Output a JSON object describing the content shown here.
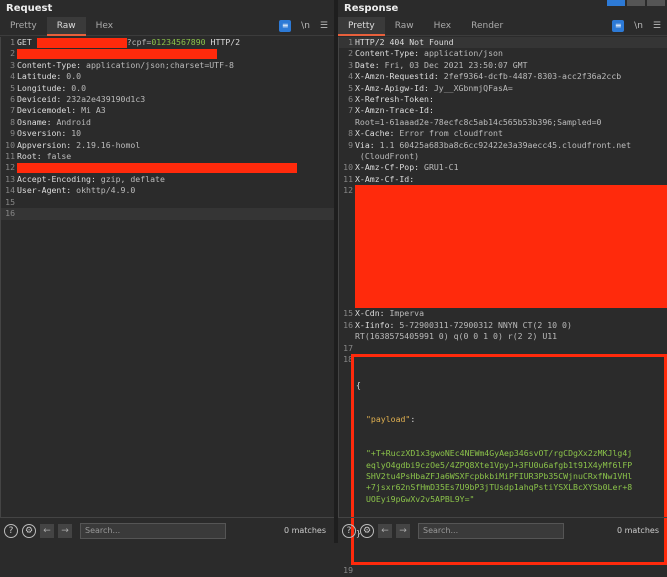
{
  "request": {
    "title": "Request",
    "tabs": [
      "Pretty",
      "Raw",
      "Hex"
    ],
    "active_tab": "Raw",
    "lines": [
      {
        "n": "1",
        "parts": [
          [
            "GET ",
            "key"
          ],
          [
            "",
            "red90"
          ],
          [
            "?cpf=",
            "val"
          ],
          [
            "01234567890",
            "grn"
          ],
          [
            " HTTP/2",
            "key"
          ]
        ]
      },
      {
        "n": "2",
        "parts": [
          [
            "",
            "red200"
          ]
        ]
      },
      {
        "n": "3",
        "parts": [
          [
            "Content-Type:",
            "key"
          ],
          [
            " application/json;charset=UTF-8",
            "val"
          ]
        ]
      },
      {
        "n": "4",
        "parts": [
          [
            "Latitude:",
            "key"
          ],
          [
            " 0.0",
            "val"
          ]
        ]
      },
      {
        "n": "5",
        "parts": [
          [
            "Longitude:",
            "key"
          ],
          [
            " 0.0",
            "val"
          ]
        ]
      },
      {
        "n": "6",
        "parts": [
          [
            "Deviceid:",
            "key"
          ],
          [
            " 232a2e439190d1c3",
            "val"
          ]
        ]
      },
      {
        "n": "7",
        "parts": [
          [
            "Devicemodel:",
            "key"
          ],
          [
            " Mi A3",
            "val"
          ]
        ]
      },
      {
        "n": "8",
        "parts": [
          [
            "Osname:",
            "key"
          ],
          [
            " Android",
            "val"
          ]
        ]
      },
      {
        "n": "9",
        "parts": [
          [
            "Osversion:",
            "key"
          ],
          [
            " 10",
            "val"
          ]
        ]
      },
      {
        "n": "10",
        "parts": [
          [
            "Appversion:",
            "key"
          ],
          [
            " 2.19.16-homol",
            "val"
          ]
        ]
      },
      {
        "n": "11",
        "parts": [
          [
            "Root:",
            "key"
          ],
          [
            " false",
            "val"
          ]
        ]
      },
      {
        "n": "12",
        "parts": [
          [
            "",
            "red280"
          ]
        ]
      },
      {
        "n": "13",
        "parts": [
          [
            "Accept-Encoding:",
            "key"
          ],
          [
            " gzip, deflate",
            "val"
          ]
        ]
      },
      {
        "n": "14",
        "parts": [
          [
            "User-Agent:",
            "key"
          ],
          [
            " okhttp/4.9.0",
            "val"
          ]
        ]
      },
      {
        "n": "15",
        "parts": []
      },
      {
        "n": "16",
        "parts": [],
        "hl": true
      }
    ]
  },
  "response": {
    "title": "Response",
    "tabs": [
      "Pretty",
      "Raw",
      "Hex",
      "Render"
    ],
    "active_tab": "Pretty",
    "lines": [
      {
        "n": "1",
        "parts": [
          [
            "HTTP/2 404 Not Found",
            "key"
          ]
        ],
        "hl": true
      },
      {
        "n": "2",
        "parts": [
          [
            "Content-Type:",
            "key"
          ],
          [
            " application/json",
            "val"
          ]
        ]
      },
      {
        "n": "3",
        "parts": [
          [
            "Date:",
            "key"
          ],
          [
            " Fri, 03 Dec 2021 23:50:07 GMT",
            "val"
          ]
        ]
      },
      {
        "n": "4",
        "parts": [
          [
            "X-Amzn-Requestid:",
            "key"
          ],
          [
            " 2fef9364-dcfb-4487-8303-acc2f36a2ccb",
            "val"
          ]
        ]
      },
      {
        "n": "5",
        "parts": [
          [
            "X-Amz-Apigw-Id:",
            "key"
          ],
          [
            " Jy__XGbnmjQFasA=",
            "val"
          ]
        ]
      },
      {
        "n": "6",
        "parts": [
          [
            "X-Refresh-Token:",
            "key"
          ]
        ]
      },
      {
        "n": "7",
        "parts": [
          [
            "X-Amzn-Trace-Id:",
            "key"
          ]
        ]
      },
      {
        "n": "",
        "parts": [
          [
            "Root=1-61aaad2e-78ecfc8c5ab14c565b53b396;Sampled=0",
            "val"
          ]
        ]
      },
      {
        "n": "8",
        "parts": [
          [
            "X-Cache:",
            "key"
          ],
          [
            " Error from cloudfront",
            "val"
          ]
        ]
      },
      {
        "n": "9",
        "parts": [
          [
            "Via:",
            "key"
          ],
          [
            " 1.1 60425a683ba8c6cc92422e3a39aecc45.cloudfront.net",
            "val"
          ]
        ]
      },
      {
        "n": "",
        "parts": [
          [
            " (CloudFront)",
            "val"
          ]
        ]
      },
      {
        "n": "10",
        "parts": [
          [
            "X-Amz-Cf-Pop:",
            "key"
          ],
          [
            " GRU1-C1",
            "val"
          ]
        ]
      },
      {
        "n": "11",
        "parts": [
          [
            "X-Amz-Cf-Id:",
            "key"
          ]
        ]
      },
      {
        "n": "12",
        "parts": [],
        "redblock": true
      }
    ],
    "lines_after": [
      {
        "n": "15",
        "parts": [
          [
            "X-Cdn:",
            "key"
          ],
          [
            " Imperva",
            "val"
          ]
        ]
      },
      {
        "n": "16",
        "parts": [
          [
            "X-Iinfo:",
            "key"
          ],
          [
            " 5-72900311-72900312 NNYN CT(2 10 0)",
            "val"
          ]
        ]
      },
      {
        "n": "",
        "parts": [
          [
            "RT(1638575405991 0) q(0 0 1 0) r(2 2) U11",
            "val"
          ]
        ]
      },
      {
        "n": "17",
        "parts": []
      }
    ],
    "body": {
      "open": "{",
      "key": "\"payload\"",
      "colon": ":",
      "payload_lines": [
        "\"+T+RuczXD1x3gwoNEc4NEWm4GyAep346svOT/rgCDgXx2zMKJlg4j",
        "eqlyO4gdbi9czOe5/4ZPQ8Xte1VpyJ+3FU0u6afgb1t91X4yMf6lFP",
        "SHV2tu4PsHbaZFJa6WSXFcpbkbiMiPFIUR3Pb35CWjnuCRxfNw1VHl",
        "+7jsxr62nSfHmD35Es7U9bP3jTUsdp1ahqPstiYSXLBcXYSb0Ler+8",
        "UOEyi9pGwXv2v5APBL9Y=\""
      ],
      "close": "}"
    },
    "last_line": "19"
  },
  "footer": {
    "search_placeholder": "Search...",
    "matches": "0 matches"
  },
  "colors": {
    "redaction": "#ff2a0c",
    "accent": "#e8603c",
    "wrap_button": "#2d7ad6"
  }
}
